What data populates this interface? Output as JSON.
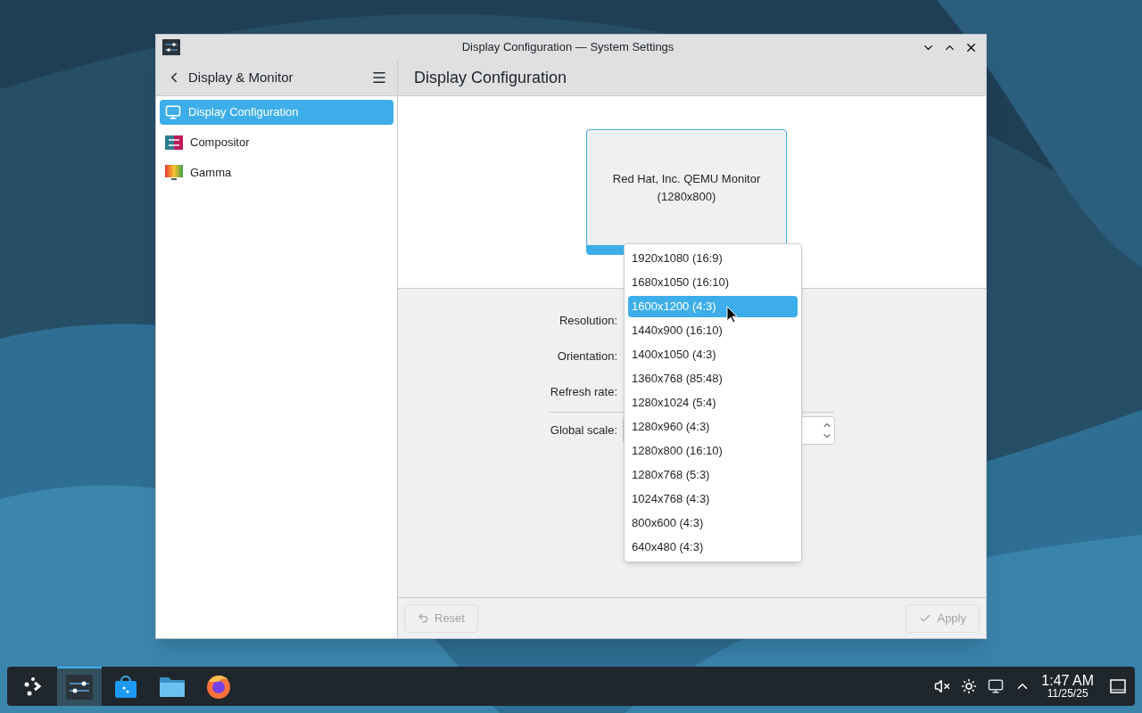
{
  "window": {
    "title": "Display Configuration — System Settings"
  },
  "sidebar": {
    "title": "Display & Monitor",
    "items": [
      {
        "label": "Display Configuration",
        "selected": true,
        "kind": "display"
      },
      {
        "label": "Compositor",
        "selected": false,
        "kind": "compositor"
      },
      {
        "label": "Gamma",
        "selected": false,
        "kind": "gamma"
      }
    ]
  },
  "page_title": "Display Configuration",
  "monitor": {
    "name": "Red Hat, Inc. QEMU Monitor",
    "resolution": "(1280x800)",
    "selected": true
  },
  "form": {
    "labels": [
      "Resolution:",
      "Orientation:",
      "Refresh rate:"
    ],
    "scale_label": "Global scale:"
  },
  "dropdown": [
    {
      "label": "1920x1080 (16:9)",
      "selected": false
    },
    {
      "label": "1680x1050 (16:10)",
      "selected": false
    },
    {
      "label": "1600x1200 (4:3)",
      "selected": true
    },
    {
      "label": "1440x900 (16:10)",
      "selected": false
    },
    {
      "label": "1400x1050 (4:3)",
      "selected": false
    },
    {
      "label": "1360x768 (85:48)",
      "selected": false
    },
    {
      "label": "1280x1024 (5:4)",
      "selected": false
    },
    {
      "label": "1280x960 (4:3)",
      "selected": false
    },
    {
      "label": "1280x800 (16:10)",
      "selected": false
    },
    {
      "label": "1280x768 (5:3)",
      "selected": false
    },
    {
      "label": "1024x768 (4:3)",
      "selected": false
    },
    {
      "label": "800x600 (4:3)",
      "selected": false
    },
    {
      "label": "640x480 (4:3)",
      "selected": false
    }
  ],
  "buttons": [
    {
      "label": "Reset",
      "kind": "reset",
      "disabled": true
    },
    {
      "label": "Apply",
      "kind": "apply",
      "disabled": true
    }
  ],
  "taskbar": {
    "apps": [
      {
        "kind": "launcher",
        "selected": false
      },
      {
        "kind": "settings",
        "selected": true
      },
      {
        "kind": "store",
        "selected": false
      },
      {
        "kind": "files",
        "selected": false
      },
      {
        "kind": "browser",
        "selected": false
      }
    ],
    "clock": {
      "time": "1:47 AM",
      "date": "11/25/25"
    }
  }
}
